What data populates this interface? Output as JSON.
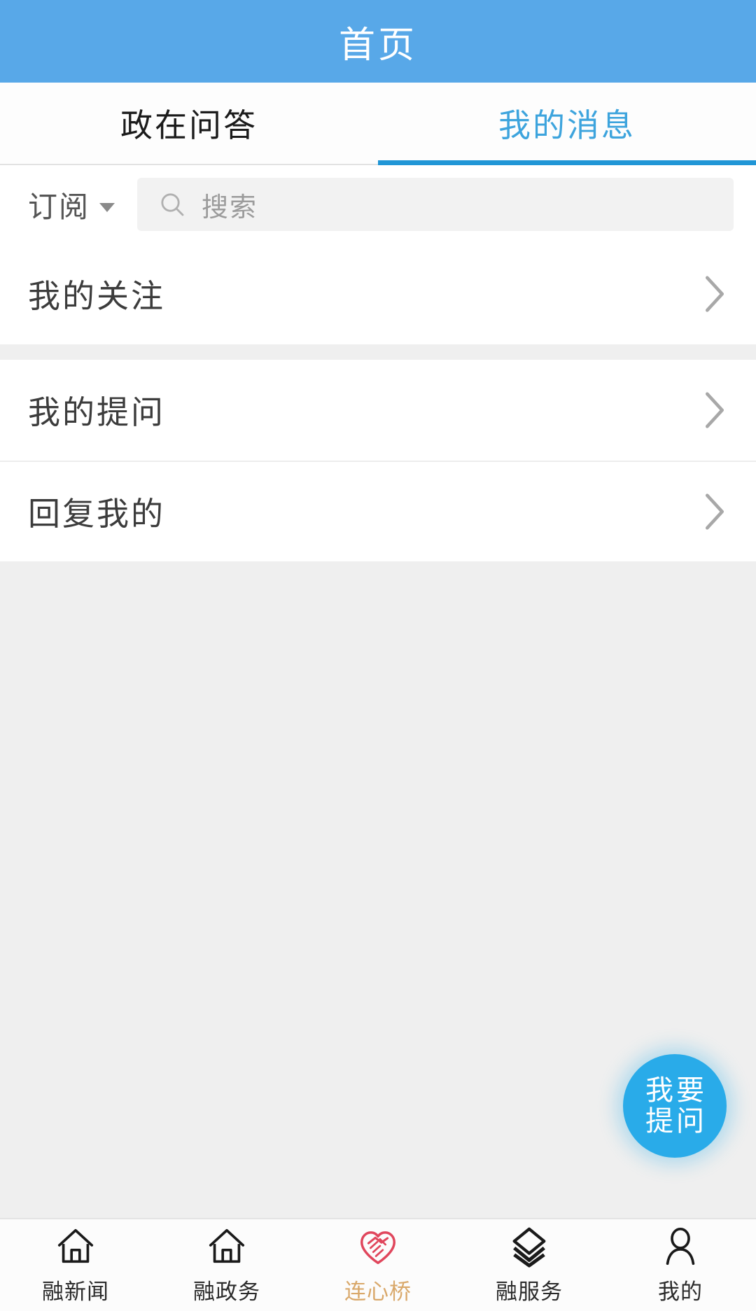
{
  "header": {
    "title": "首页"
  },
  "tabs": [
    {
      "label": "政在问答",
      "active": false
    },
    {
      "label": "我的消息",
      "active": true
    }
  ],
  "search": {
    "subscribe_label": "订阅",
    "dropdown_icon": "caret-down-icon",
    "search_icon": "search-icon",
    "placeholder": "搜索",
    "value": ""
  },
  "list": {
    "chevron_icon": "chevron-right-icon",
    "group_a": [
      {
        "label": "我的关注"
      }
    ],
    "group_b": [
      {
        "label": "我的提问"
      },
      {
        "label": "回复我的"
      }
    ]
  },
  "fab": {
    "name": "ask-question-button",
    "chars": [
      "我",
      "要",
      "提",
      "问"
    ],
    "text": "我要提问"
  },
  "bottom_nav": [
    {
      "label": "融新闻",
      "icon": "home-icon",
      "active": false
    },
    {
      "label": "融政务",
      "icon": "home-icon",
      "active": false
    },
    {
      "label": "连心桥",
      "icon": "heart-handshake-icon",
      "active": true
    },
    {
      "label": "融服务",
      "icon": "layers-icon",
      "active": false
    },
    {
      "label": "我的",
      "icon": "person-icon",
      "active": false
    }
  ],
  "colors": {
    "header_blue": "#58a8e8",
    "tab_active_blue": "#3da4dd",
    "tab_indicator_blue": "#2196d6",
    "fab_blue": "#29abe9",
    "nav_active_label": "#d9a86a",
    "nav_active_icon": "#e0465c",
    "page_bg": "#efefef"
  }
}
